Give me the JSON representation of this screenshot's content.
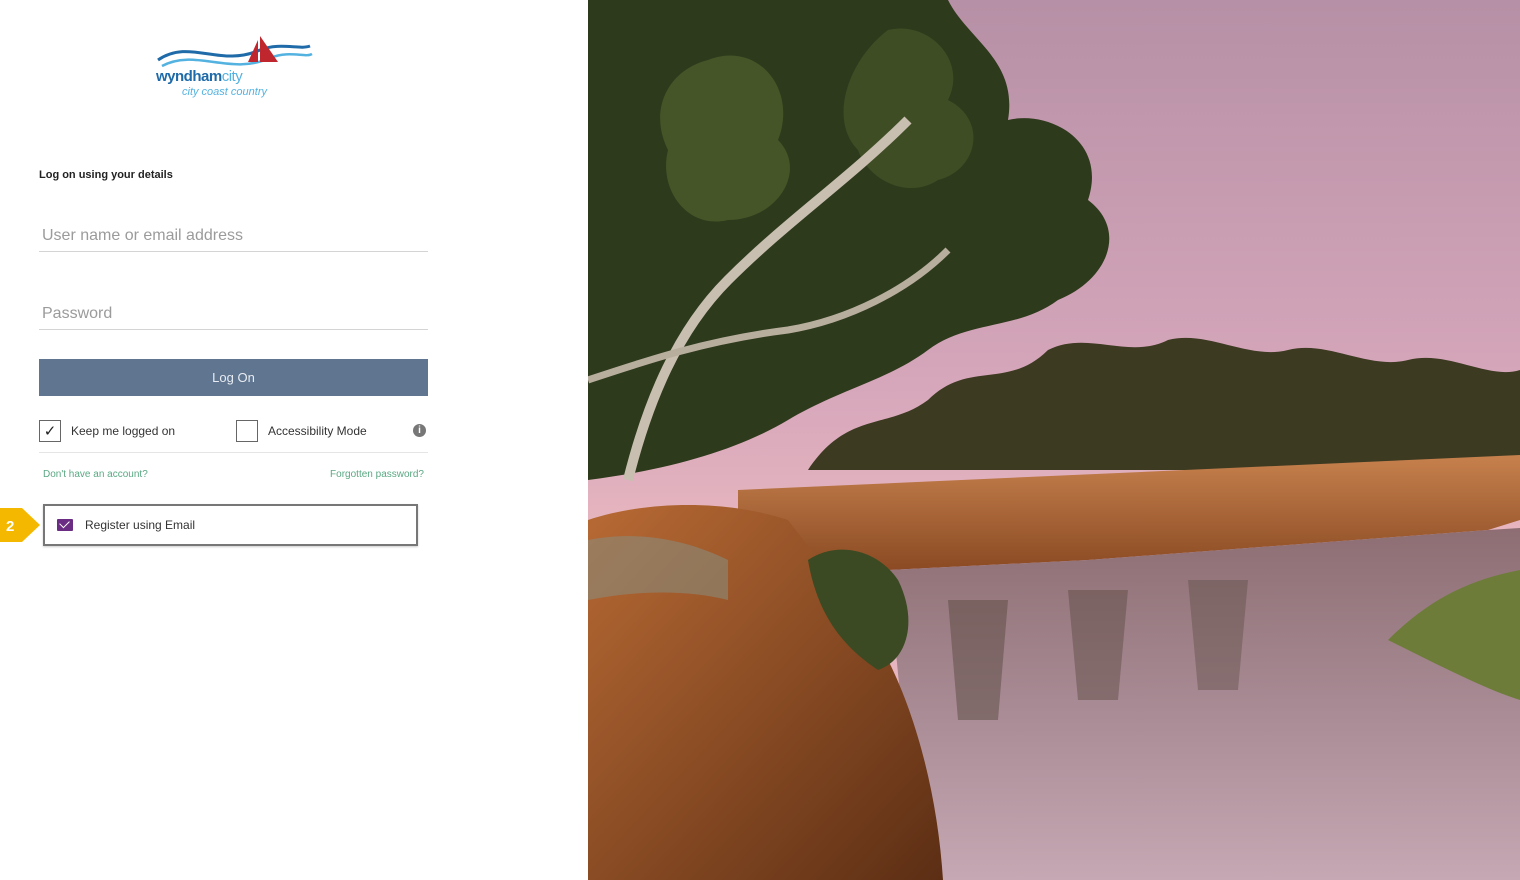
{
  "logo": {
    "word": "wyndham",
    "word_city": "city",
    "tagline": "city coast country"
  },
  "login": {
    "heading": "Log on using your details",
    "username_placeholder": "User name or email address",
    "password_placeholder": "Password",
    "logon_label": "Log On",
    "keep_logged_label": "Keep me logged on",
    "keep_logged_checked": true,
    "keep_logged_mark": "✓",
    "accessibility_label": "Accessibility Mode",
    "info_icon_glyph": "i",
    "no_account_link": "Don't have an account?",
    "forgot_link": "Forgotten password?",
    "register_email_label": "Register using Email"
  },
  "callout": {
    "label": "2"
  },
  "colors": {
    "logon_button": "#5f7590",
    "link_green": "#5aa882",
    "mail_purple": "#6b2c84",
    "callout_yellow": "#f5b800"
  }
}
